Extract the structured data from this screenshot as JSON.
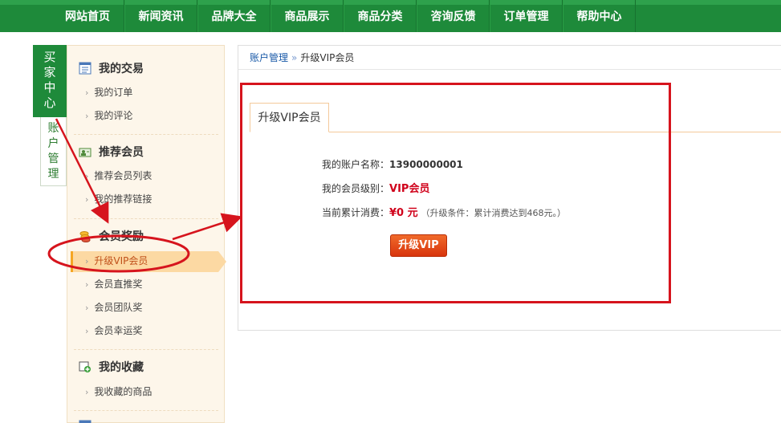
{
  "topnav": {
    "items": [
      "网站首页",
      "新闻资讯",
      "品牌大全",
      "商品展示",
      "商品分类",
      "咨询反馈",
      "订单管理",
      "帮助中心"
    ]
  },
  "side_tabs": {
    "buyer_center": "买家中心",
    "account_mgmt": "账户管理"
  },
  "sidebar": {
    "sections": [
      {
        "title": "我的交易",
        "icon": "list-icon",
        "items": [
          "我的订单",
          "我的评论"
        ]
      },
      {
        "title": "推荐会员",
        "icon": "user-card-icon",
        "items": [
          "推荐会员列表",
          "我的推荐链接"
        ]
      },
      {
        "title": "会员奖励",
        "icon": "coins-icon",
        "items": [
          "升级VIP会员",
          "会员直推奖",
          "会员团队奖",
          "会员幸运奖"
        ]
      },
      {
        "title": "我的收藏",
        "icon": "add-favorite-icon",
        "items": [
          "我收藏的商品"
        ]
      }
    ],
    "active_item": "升级VIP会员"
  },
  "breadcrumb": {
    "parent": "账户管理",
    "separator": "»",
    "current": "升级VIP会员"
  },
  "main": {
    "tab_label": "升级VIP会员",
    "account_label": "我的账户名称：",
    "account_value": "13900000001",
    "level_label": "我的会员级别：",
    "level_value": "VIP会员",
    "spend_label": "当前累计消费：",
    "spend_value": "¥0 元",
    "spend_hint": "（升级条件：累计消费达到468元。）",
    "upgrade_button": "升级VIP"
  },
  "colors": {
    "nav_green": "#1e8a3a",
    "sidebar_bg": "#fdf6ea",
    "active_bg": "#fcd9a3",
    "annotation_red": "#d6141d",
    "button_orange": "#e24a1a"
  }
}
